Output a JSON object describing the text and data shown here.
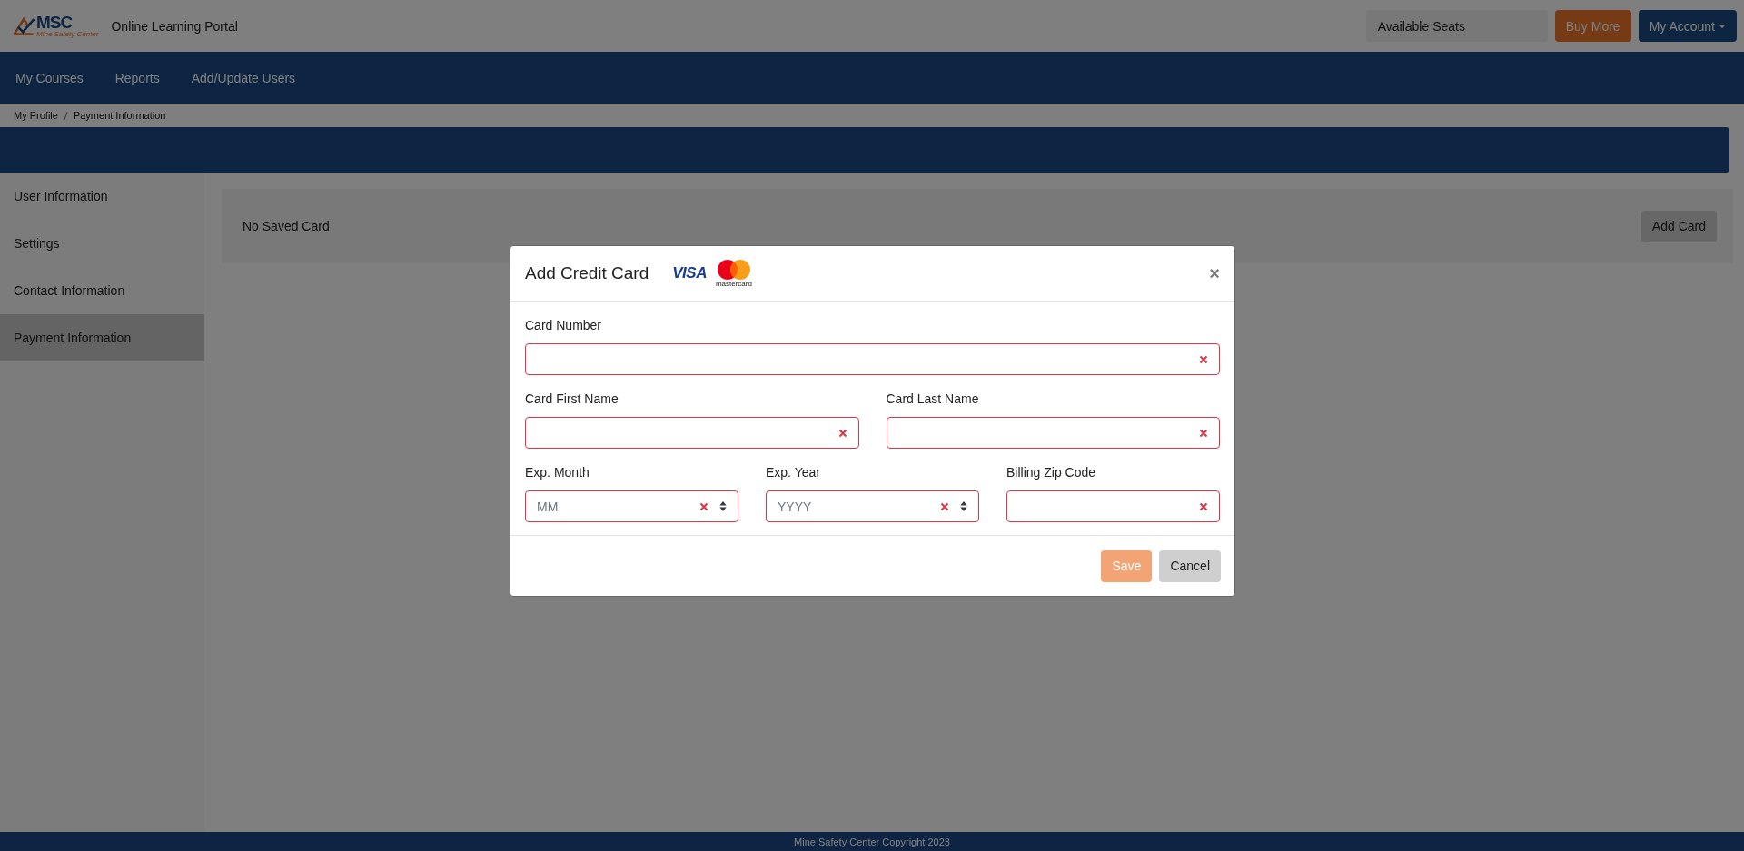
{
  "header": {
    "logo": {
      "mark": "MSC",
      "tagline": "Mine Safety Center"
    },
    "portal_title": "Online Learning Portal",
    "seats_label": "Available Seats",
    "buy_button": "Buy More",
    "account_button": "My Account"
  },
  "nav": {
    "items": [
      "My Courses",
      "Reports",
      "Add/Update Users"
    ]
  },
  "breadcrumb": [
    "My Profile",
    "Payment Information"
  ],
  "sidebar": {
    "items": [
      {
        "label": "User Information",
        "selected": false
      },
      {
        "label": "Settings",
        "selected": false
      },
      {
        "label": "Contact Information",
        "selected": false
      },
      {
        "label": "Payment Information",
        "selected": true
      }
    ]
  },
  "saved_cards": {
    "message": "No Saved Card",
    "add_button": "Add Card"
  },
  "modal": {
    "title": "Add Credit Card",
    "close": "×",
    "visa_label": "VISA",
    "mastercard_label": "mastercard",
    "rows": [
      [
        {
          "label": "Card Number",
          "kind": "text",
          "invalid": true
        }
      ],
      [
        {
          "label": "Card First Name",
          "kind": "text",
          "invalid": true
        },
        {
          "label": "Card Last Name",
          "kind": "text",
          "invalid": true
        }
      ],
      [
        {
          "label": "Exp. Month",
          "kind": "select",
          "placeholder": "MM",
          "invalid": true
        },
        {
          "label": "Exp. Year",
          "kind": "select",
          "placeholder": "YYYY",
          "invalid": true
        },
        {
          "label": "Billing Zip Code",
          "kind": "text",
          "invalid": true
        }
      ]
    ],
    "save_button": {
      "label": "Save",
      "disabled": true
    },
    "cancel_button": "Cancel"
  },
  "footer": "Mine Safety Center Copyright 2023"
}
